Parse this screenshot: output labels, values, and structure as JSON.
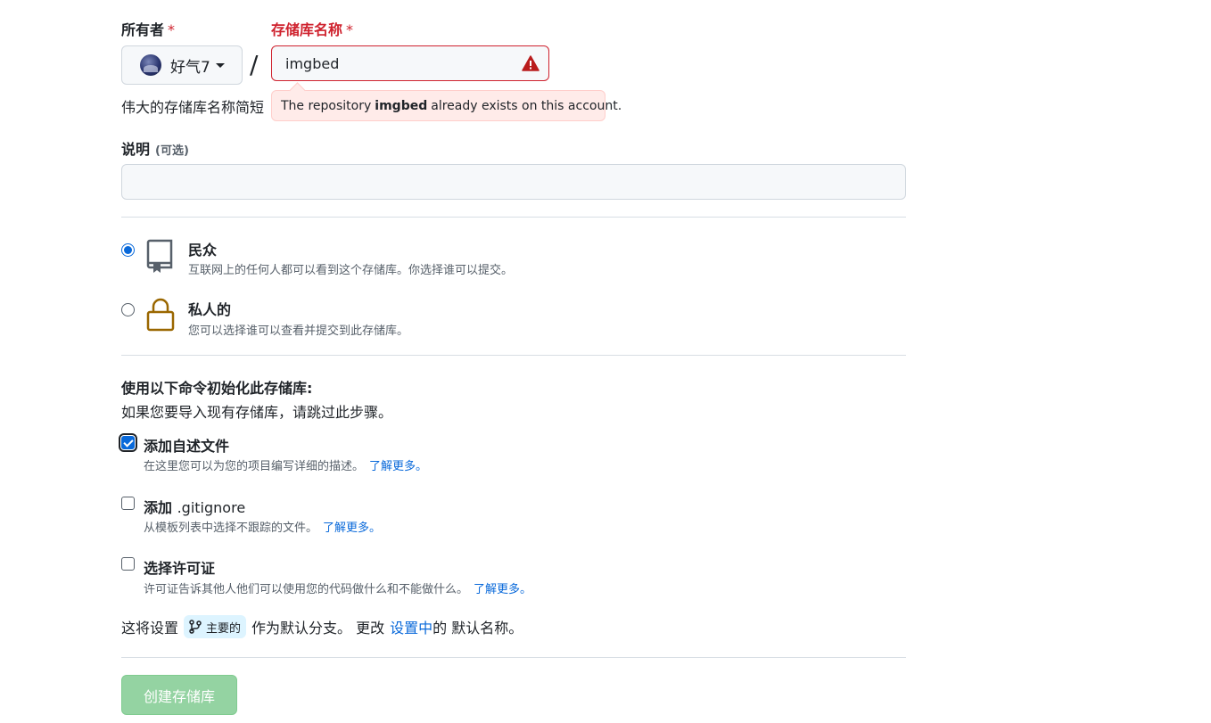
{
  "owner": {
    "label": "所有者",
    "required_mark": "*",
    "selected": "好气7",
    "avatar": "avatar"
  },
  "separator": "/",
  "repo_name": {
    "label": "存储库名称",
    "required_mark": "*",
    "value": "imgbed",
    "error_icon": "alert-triangle-icon"
  },
  "name_help_text": "伟大的存储库名称简短",
  "error_tooltip": {
    "prefix": "The repository",
    "name": "imgbed",
    "suffix": "already exists on this account."
  },
  "description": {
    "label": "说明",
    "optional": "(可选)",
    "value": "",
    "placeholder": ""
  },
  "visibility": {
    "options": [
      {
        "title": "民众",
        "note": "互联网上的任何人都可以看到这个存储库。你选择谁可以提交。",
        "icon": "repo-icon",
        "checked": true
      },
      {
        "title": "私人的",
        "note": "您可以选择谁可以查看并提交到此存储库。",
        "icon": "lock-icon",
        "checked": false
      }
    ]
  },
  "init": {
    "title": "使用以下命令初始化此存储库:",
    "note": "如果您要导入现有存储库，请跳过此步骤。",
    "options": [
      {
        "title": "添加自述文件",
        "note": "在这里您可以为您的项目编写详细的描述。",
        "link": "了解更多。",
        "checked": true
      },
      {
        "title_bold": "添加",
        "title_plain": ".gitignore",
        "note": "从模板列表中选择不跟踪的文件。",
        "link": "了解更多。",
        "checked": false
      },
      {
        "title": "选择许可证",
        "note": "许可证告诉其他人他们可以使用您的代码做什么和不能做什么。",
        "link": "了解更多。",
        "checked": false
      }
    ]
  },
  "branch": {
    "prefix": "这将设置",
    "name": "主要的",
    "middle": "作为默认分支。 更改",
    "link": "设置中",
    "suffix": "的 默认名称。",
    "icon": "git-branch-icon"
  },
  "submit": {
    "label": "创建存储库"
  },
  "colors": {
    "accent": "#0969da",
    "danger": "#cf222e",
    "error_bg": "#ffebe9",
    "create_button": "#94d3a2",
    "lock_icon": "#9a6700"
  }
}
